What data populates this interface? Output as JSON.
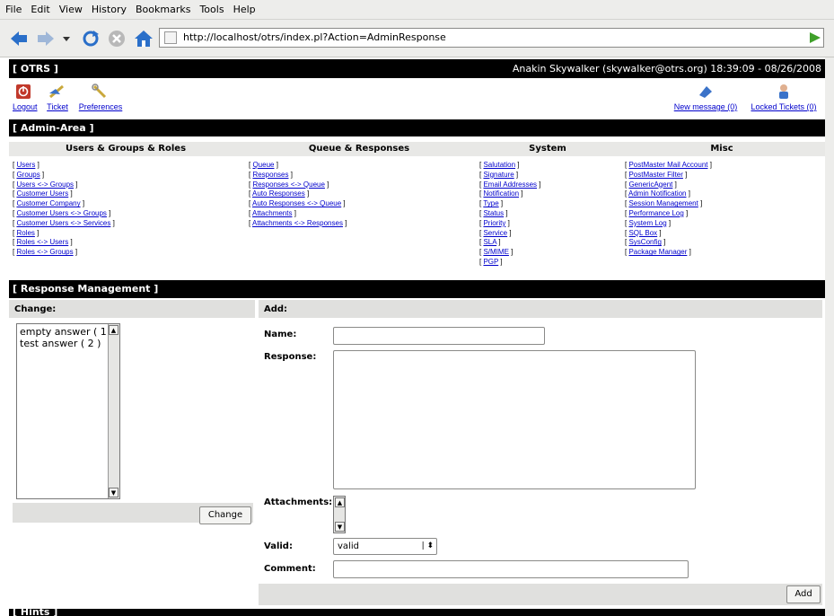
{
  "browser": {
    "menu": [
      "File",
      "Edit",
      "View",
      "History",
      "Bookmarks",
      "Tools",
      "Help"
    ],
    "url": "http://localhost/otrs/index.pl?Action=AdminResponse",
    "icons": [
      "back-arrow-icon",
      "forward-arrow-icon",
      "dropdown-arrow-icon",
      "reload-icon",
      "stop-icon",
      "home-icon",
      "favicon-icon",
      "go-icon"
    ]
  },
  "header": {
    "brand": "[ OTRS ]",
    "user_info": "Anakin Skywalker (skywalker@otrs.org) 18:39:09 - 08/26/2008"
  },
  "nav": {
    "logout": "Logout",
    "ticket": "Ticket",
    "preferences": "Preferences",
    "new_message": "New message (0)",
    "locked_tickets": "Locked Tickets (0)"
  },
  "admin": {
    "title": "[ Admin-Area ]",
    "columns": [
      {
        "heading": "Users & Groups & Roles",
        "items": [
          "Users",
          "Groups",
          "Users <-> Groups",
          "Customer Users",
          "Customer Company",
          "Customer Users <-> Groups",
          "Customer Users <-> Services",
          "Roles",
          "Roles <-> Users",
          "Roles <-> Groups"
        ]
      },
      {
        "heading": "Queue & Responses",
        "items": [
          "Queue",
          "Responses",
          "Responses <-> Queue",
          "Auto Responses",
          "Auto Responses <-> Queue",
          "Attachments",
          "Attachments <-> Responses"
        ]
      },
      {
        "heading": "System",
        "items": [
          "Salutation",
          "Signature",
          "Email Addresses",
          "Notification",
          "Type",
          "Status",
          "Priority",
          "Service",
          "SLA",
          "S/MIME",
          "PGP"
        ]
      },
      {
        "heading": "Misc",
        "items": [
          "PostMaster Mail Account",
          "PostMaster Filter",
          "GenericAgent",
          "Admin Notification",
          "Session Management",
          "Performance Log",
          "System Log",
          "SQL Box",
          "SysConfig",
          "Package Manager"
        ]
      }
    ]
  },
  "response": {
    "title": "[ Response Management ]",
    "change_label": "Change:",
    "list_items": [
      "empty answer ( 1 )",
      "test answer ( 2 )"
    ],
    "change_button": "Change",
    "add_label": "Add:",
    "name_label": "Name:",
    "response_label": "Response:",
    "attachments_label": "Attachments:",
    "valid_label": "Valid:",
    "valid_value": "valid",
    "comment_label": "Comment:",
    "add_button": "Add"
  },
  "footer": {
    "partial_title": "[ Hints ]"
  }
}
